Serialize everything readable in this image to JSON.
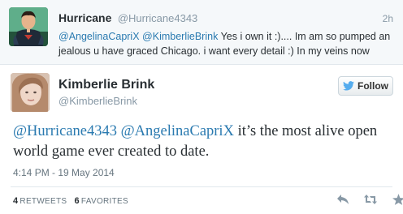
{
  "reply": {
    "name": "Hurricane",
    "handle": "@Hurricane4343",
    "time": "2h",
    "mention_1": "@AngelinaCapriX",
    "mention_2": "@KimberlieBrink",
    "text": "Yes i own it :).... Im am so pumped an jealous u have graced Chicago. i want every detail :) In my veins now",
    "avatar_icon": "superhero-avatar"
  },
  "tweet": {
    "name": "Kimberlie Brink",
    "handle": "@KimberlieBrink",
    "avatar_icon": "woman-avatar",
    "follow_label": "Follow",
    "follow_icon": "bird-icon",
    "mention_1": "@Hurricane4343",
    "mention_2": "@AngelinaCapriX",
    "text": "it’s the most alive open world game ever created to date.",
    "timestamp": "4:14 PM - 19 May 2014",
    "retweets_count": "4",
    "retweets_label": "RETWEETS",
    "favorites_count": "6",
    "favorites_label": "FAVORITES"
  },
  "colors": {
    "link": "#2a7ab0",
    "muted": "#8899a6",
    "icon": "#8899a6",
    "bird": "#55acee"
  },
  "actions": [
    "reply-icon",
    "retweet-icon",
    "favorite-icon"
  ]
}
